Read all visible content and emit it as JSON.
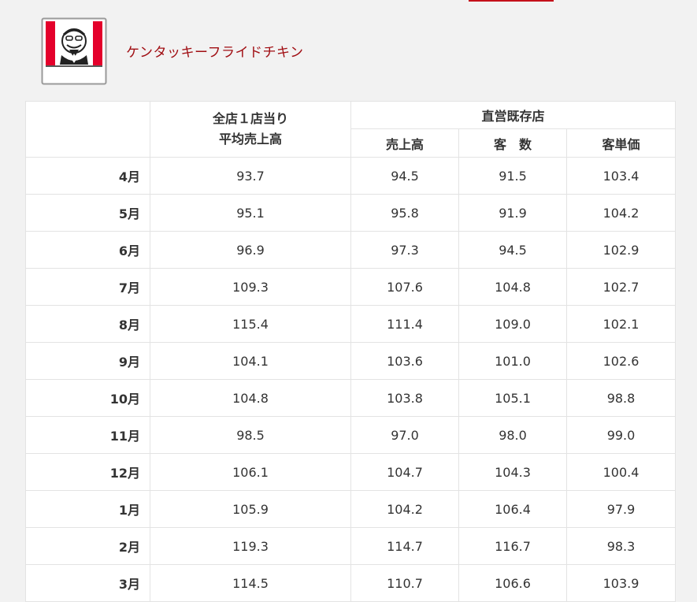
{
  "brand": {
    "name": "ケンタッキーフライドチキン",
    "logo_text": "KFC",
    "accent_color": "#c4101b",
    "name_color": "#a00d12"
  },
  "table": {
    "headers": {
      "avg_sales_line1": "全店１店当り",
      "avg_sales_line2": "平均売上高",
      "existing_stores": "直営既存店",
      "sales": "売上高",
      "customers": "客　数",
      "unit_price": "客単価"
    },
    "rows": [
      {
        "month": "4月",
        "avg": "93.7",
        "sales": "94.5",
        "customers": "91.5",
        "unit_price": "103.4"
      },
      {
        "month": "5月",
        "avg": "95.1",
        "sales": "95.8",
        "customers": "91.9",
        "unit_price": "104.2"
      },
      {
        "month": "6月",
        "avg": "96.9",
        "sales": "97.3",
        "customers": "94.5",
        "unit_price": "102.9"
      },
      {
        "month": "7月",
        "avg": "109.3",
        "sales": "107.6",
        "customers": "104.8",
        "unit_price": "102.7"
      },
      {
        "month": "8月",
        "avg": "115.4",
        "sales": "111.4",
        "customers": "109.0",
        "unit_price": "102.1"
      },
      {
        "month": "9月",
        "avg": "104.1",
        "sales": "103.6",
        "customers": "101.0",
        "unit_price": "102.6"
      },
      {
        "month": "10月",
        "avg": "104.8",
        "sales": "103.8",
        "customers": "105.1",
        "unit_price": "98.8"
      },
      {
        "month": "11月",
        "avg": "98.5",
        "sales": "97.0",
        "customers": "98.0",
        "unit_price": "99.0"
      },
      {
        "month": "12月",
        "avg": "106.1",
        "sales": "104.7",
        "customers": "104.3",
        "unit_price": "100.4"
      },
      {
        "month": "1月",
        "avg": "105.9",
        "sales": "104.2",
        "customers": "106.4",
        "unit_price": "97.9"
      },
      {
        "month": "2月",
        "avg": "119.3",
        "sales": "114.7",
        "customers": "116.7",
        "unit_price": "98.3"
      },
      {
        "month": "3月",
        "avg": "114.5",
        "sales": "110.7",
        "customers": "106.6",
        "unit_price": "103.9"
      }
    ]
  }
}
